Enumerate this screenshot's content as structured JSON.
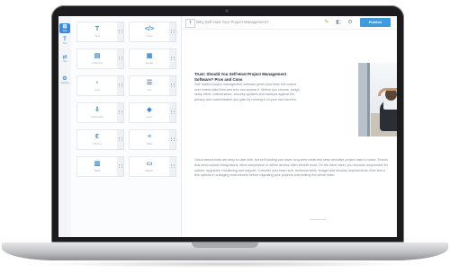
{
  "editor": {
    "doc_title": "Why Self-Host Your Project Management?",
    "publish_label": "Publish"
  },
  "rail": [
    {
      "glyph": "⊞",
      "label": "Add",
      "active": true
    },
    {
      "glyph": "T",
      "label": "Text",
      "active": false
    },
    {
      "glyph": "⇄",
      "label": "Link",
      "active": false
    },
    {
      "glyph": "⚙",
      "label": "Settings",
      "active": false
    }
  ],
  "blocks": [
    {
      "icon": "T",
      "label": "Text"
    },
    {
      "icon": "</>",
      "label": "Code"
    },
    {
      "icon": "▤",
      "label": "Columns"
    },
    {
      "icon": "▦",
      "label": "Image"
    },
    {
      "icon": "♀",
      "label": "Icon"
    },
    {
      "icon": "☰",
      "label": "List"
    },
    {
      "icon": "⇩",
      "label": "Download"
    },
    {
      "icon": "◆",
      "label": "Layer"
    },
    {
      "icon": "€",
      "label": "Pricing"
    },
    {
      "icon": "≡",
      "label": "Tabs"
    },
    {
      "icon": "▥",
      "label": "Table"
    },
    {
      "icon": "▭",
      "label": "Button"
    }
  ],
  "content": {
    "headline": "Trust: Should You Self-Host Project Management Software? Pros and Cons",
    "intro": "Self-hosted project management software gives your team full control over where data lives and who can access it. Before you choose, weigh setup effort, maintenance, security updates and backups against the privacy and customization you gain by running it on your own servers.",
    "body": "Cloud-based tools are easy to start with, but self-hosting can lower long-term costs and keep sensitive project data in house. Teams that need custom integrations, strict compliance or offline access often benefit most. On the other hand, you become responsible for uptime, upgrades, monitoring and support. Consider your team size, technical skills, budget and security requirements, then test a few options in a staging environment before migrating your projects and inviting the whole team."
  }
}
